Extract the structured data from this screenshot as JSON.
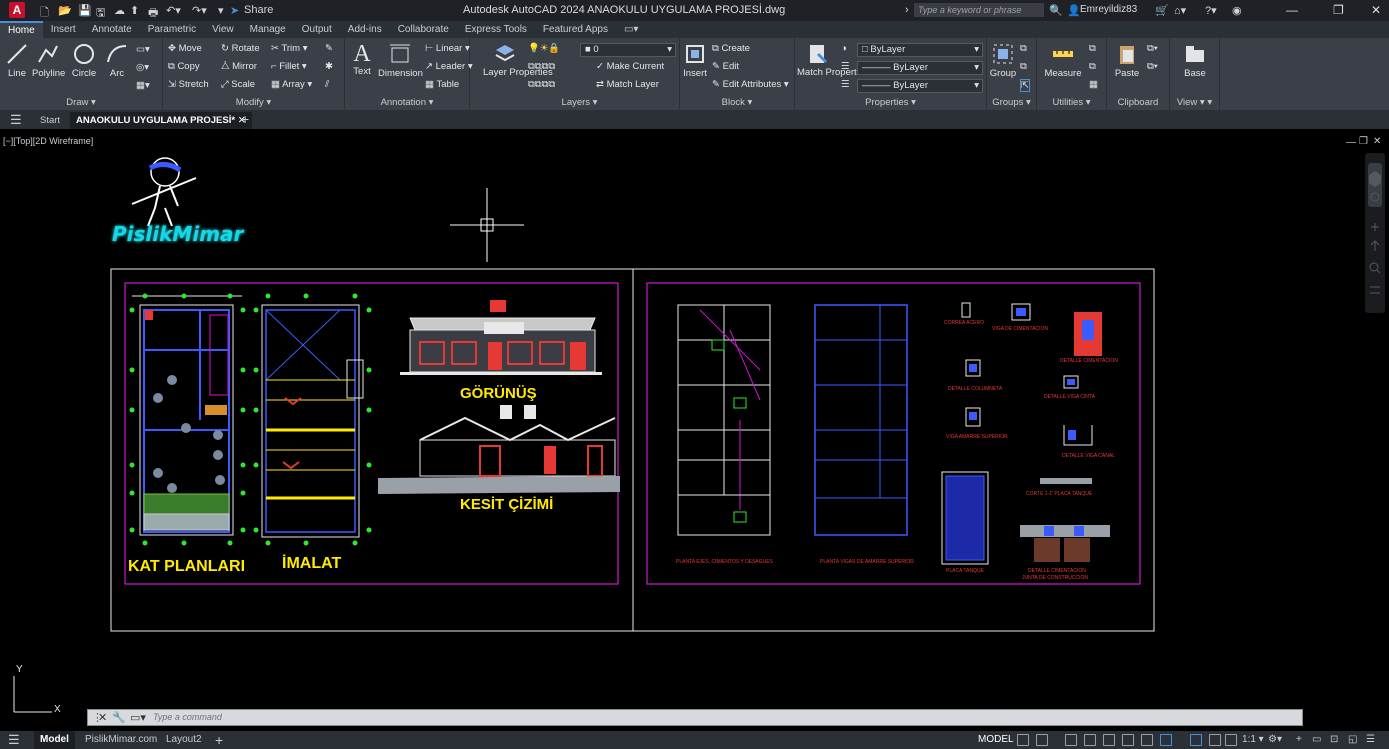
{
  "title_bar": {
    "app_logo": "A",
    "share_label": "Share",
    "title": "Autodesk AutoCAD 2024    ANAOKULU UYGULAMA PROJESİ.dwg",
    "search_placeholder": "Type a keyword or phrase",
    "user": "Emreyildiz83"
  },
  "ribbon_tabs": [
    "Home",
    "Insert",
    "Annotate",
    "Parametric",
    "View",
    "Manage",
    "Output",
    "Add-ins",
    "Collaborate",
    "Express Tools",
    "Featured Apps"
  ],
  "ribbon": {
    "draw": {
      "title": "Draw",
      "line": "Line",
      "polyline": "Polyline",
      "circle": "Circle",
      "arc": "Arc"
    },
    "modify": {
      "title": "Modify",
      "move": "Move",
      "rotate": "Rotate",
      "trim": "Trim",
      "copy": "Copy",
      "mirror": "Mirror",
      "fillet": "Fillet",
      "stretch": "Stretch",
      "scale": "Scale",
      "array": "Array"
    },
    "annotation": {
      "title": "Annotation",
      "text": "Text",
      "dimension": "Dimension",
      "linear": "Linear",
      "leader": "Leader",
      "table": "Table"
    },
    "layers": {
      "title": "Layers",
      "layer_properties": "Layer Properties",
      "layer_value": "0",
      "make_current": "Make Current",
      "match_layer": "Match Layer"
    },
    "block": {
      "title": "Block",
      "insert": "Insert",
      "create": "Create",
      "edit": "Edit",
      "edit_attributes": "Edit Attributes"
    },
    "properties": {
      "title": "Properties",
      "match_properties": "Match Properties",
      "color": "ByLayer",
      "linetype": "ByLayer",
      "lineweight": "ByLayer"
    },
    "groups": {
      "title": "Groups",
      "group": "Group"
    },
    "utilities": {
      "title": "Utilities",
      "measure": "Measure"
    },
    "clipboard": {
      "title": "Clipboard",
      "paste": "Paste"
    },
    "view": {
      "title": "View",
      "base": "Base"
    }
  },
  "doc_tabs": {
    "start": "Start",
    "active": "ANAOKULU UYGULAMA PROJESİ*"
  },
  "viewport_label": "[−][Top][2D Wireframe]",
  "drawing": {
    "logo_text": "PislikMimar",
    "sheet1": {
      "plans": "KAT PLANLARI",
      "imalat": "İMALAT",
      "gorunus": "GÖRÜNÜŞ",
      "kesit": "KESİT ÇİZİMİ"
    },
    "sheet2": {
      "planta1": "PLANTA EJES, CIMIENTOS Y DESAGUES",
      "planta2": "PLANTA VIGAS DE AMARRE SUPERIOR",
      "correa": "CORREA ACERO",
      "viga_cim": "VIGA DE CIMENTACION",
      "det_cim": "DETALLE CIMENTACION",
      "det_col": "DETALLE COLUMNETA",
      "det_viga_cinta": "DETALLE VIGA CINTA",
      "viga_amarre": "VIGA AMARRE SUPERIOR",
      "det_viga_canal": "DETALLE VIGA CANAL",
      "corte_placa": "CORTE 1-1' PLACA TANQUE",
      "placa_tanque": "PLACA TANQUE",
      "det_cim2": "DETALLE CIMENTACION",
      "junta": "JUNTA DE CONSTRUCCION"
    }
  },
  "command_line": {
    "placeholder": "Type  a  command"
  },
  "status_bar": {
    "model_tab": "Model",
    "layout1": "PislikMimar.com",
    "layout2": "Layout2",
    "model_label": "MODEL",
    "scale": "1:1"
  },
  "colors": {
    "accent": "#4a90d9",
    "ribbon": "#3b4048",
    "canvas": "#000000",
    "titlebar": "#1f2127",
    "drawing_yellow": "#ffea00",
    "frame_magenta": "#d017d0"
  }
}
